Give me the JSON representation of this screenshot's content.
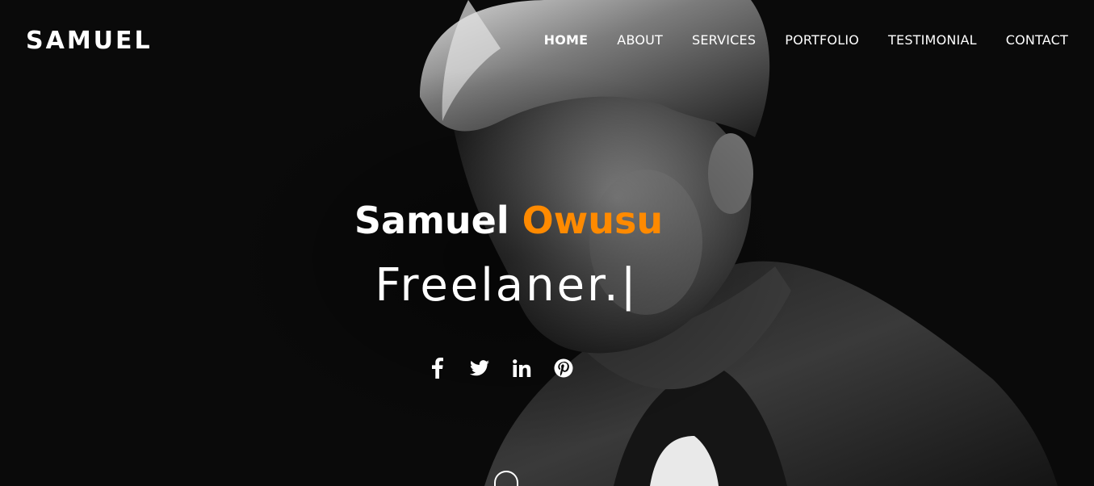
{
  "header": {
    "brand": "SAMUEL",
    "nav": [
      {
        "label": "HOME",
        "active": true
      },
      {
        "label": "ABOUT",
        "active": false
      },
      {
        "label": "SERVICES",
        "active": false
      },
      {
        "label": "PORTFOLIO",
        "active": false
      },
      {
        "label": "TESTIMONIAL",
        "active": false
      },
      {
        "label": "CONTACT",
        "active": false
      }
    ]
  },
  "hero": {
    "first_name": "Samuel",
    "last_name": "Owusu",
    "typed_role": "Freelaner.",
    "cursor": "|",
    "accent_color": "#ff8a00",
    "social": [
      {
        "icon": "facebook-icon"
      },
      {
        "icon": "twitter-icon"
      },
      {
        "icon": "linkedin-icon"
      },
      {
        "icon": "pinterest-icon"
      }
    ]
  }
}
